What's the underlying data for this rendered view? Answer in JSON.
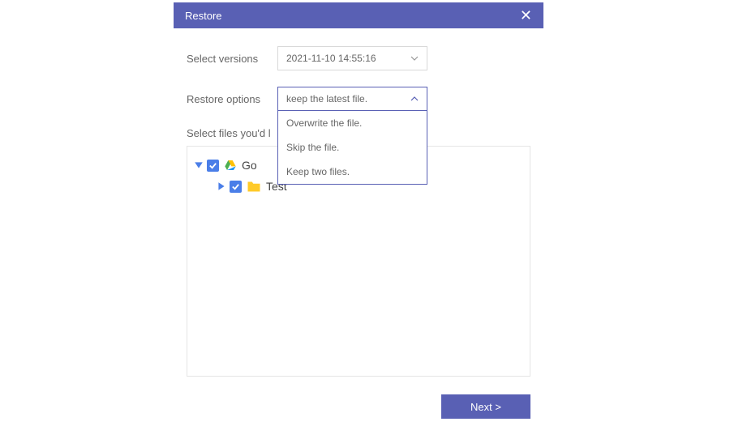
{
  "header": {
    "title": "Restore"
  },
  "versions": {
    "label": "Select versions",
    "value": "2021-11-10 14:55:16"
  },
  "restore_options": {
    "label": "Restore options",
    "value": "keep the latest file.",
    "options": [
      "Overwrite the file.",
      "Skip the file.",
      "Keep two files."
    ]
  },
  "hint": "Select files you'd l",
  "tree": {
    "root": {
      "name": "Go"
    },
    "child": {
      "name": "Test"
    }
  },
  "footer": {
    "next": "Next >"
  }
}
